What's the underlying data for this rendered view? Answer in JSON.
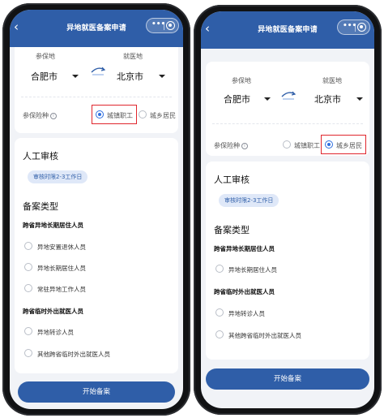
{
  "nav": {
    "title": "异地就医备案申请",
    "back_icon": "chevron-left-icon",
    "more_icon": "more-dots-icon",
    "record_icon": "target-icon"
  },
  "location": {
    "insured_label": "参保地",
    "treatment_label": "就医地",
    "insured_city": "合肥市",
    "treatment_city": "北京市",
    "swap_icon": "swap-arrows-icon"
  },
  "insurance": {
    "label": "参保险种",
    "options": [
      "城镇职工",
      "城乡居民"
    ]
  },
  "left_phone": {
    "insurance_selected": "城镇职工"
  },
  "right_phone": {
    "insurance_selected": "城乡居民"
  },
  "review": {
    "title": "人工审核",
    "time_tag": "审核时限2-3工作日"
  },
  "filing": {
    "title": "备案类型",
    "groups": [
      {
        "title": "跨省异地长期居住人员",
        "items": [
          "异地安置退休人员",
          "异地长期居住人员",
          "常驻异地工作人员"
        ]
      },
      {
        "title": "跨省临时外出就医人员",
        "items": [
          "异地转诊人员",
          "其他跨省临时外出就医人员"
        ]
      }
    ]
  },
  "submit_label": "开始备案",
  "colors": {
    "primary": "#2f5ea8",
    "radio_on": "#2f6fe0",
    "highlight": "#e0262d",
    "tag_bg": "#dfe8f8"
  }
}
